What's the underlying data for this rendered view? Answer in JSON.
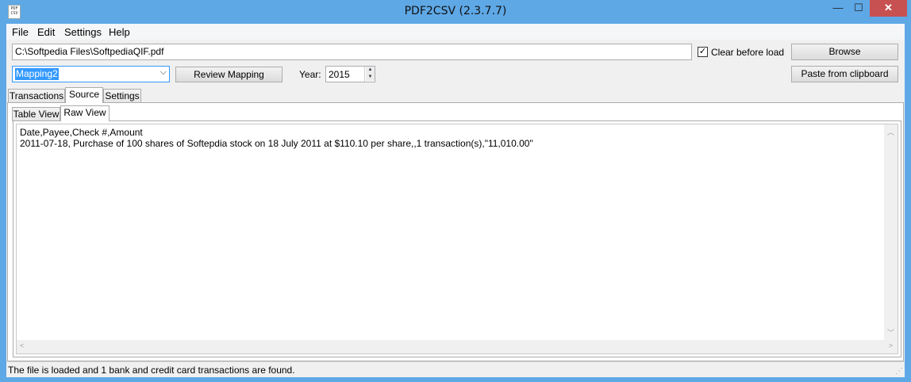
{
  "window": {
    "title": "PDF2CSV (2.3.7.7)",
    "icon_text": "PDF CSV",
    "minimize_glyph": "—",
    "maximize_glyph": "☐",
    "close_glyph": "✕"
  },
  "menu": [
    "File",
    "Edit",
    "Settings",
    "Help"
  ],
  "toolbar": {
    "path_value": "C:\\Softpedia Files\\SoftpediaQIF.pdf",
    "clear_before_load_label": "Clear before load",
    "clear_before_load_checked": true,
    "check_glyph": "✓",
    "browse_label": "Browse",
    "mapping_value": "Mapping2",
    "review_mapping_label": "Review Mapping",
    "year_label": "Year:",
    "year_value": "2015",
    "paste_label": "Paste from clipboard"
  },
  "tabs": {
    "main": [
      "Transactions",
      "Source",
      "Settings"
    ],
    "main_active": "Source",
    "inner": [
      "Table View",
      "Raw View"
    ],
    "inner_active": "Raw View"
  },
  "raw_view": {
    "lines": [
      "Date,Payee,Check #,Amount",
      "2011-07-18, Purchase of 100 shares of Softepdia stock on 18 July 2011 at $110.10 per share,,1 transaction(s),\"11,010.00\""
    ]
  },
  "status": {
    "text": "The file is loaded and 1 bank and credit card transactions are found."
  },
  "icons": {
    "dropdown": "chevron-down-icon",
    "spin_up": "triangle-up-icon",
    "spin_down": "triangle-down-icon",
    "scroll": "scroll-arrow-icon"
  },
  "colors": {
    "titlebar": "#5ea8e6",
    "close_button": "#c75050",
    "selection": "#3399ff"
  }
}
